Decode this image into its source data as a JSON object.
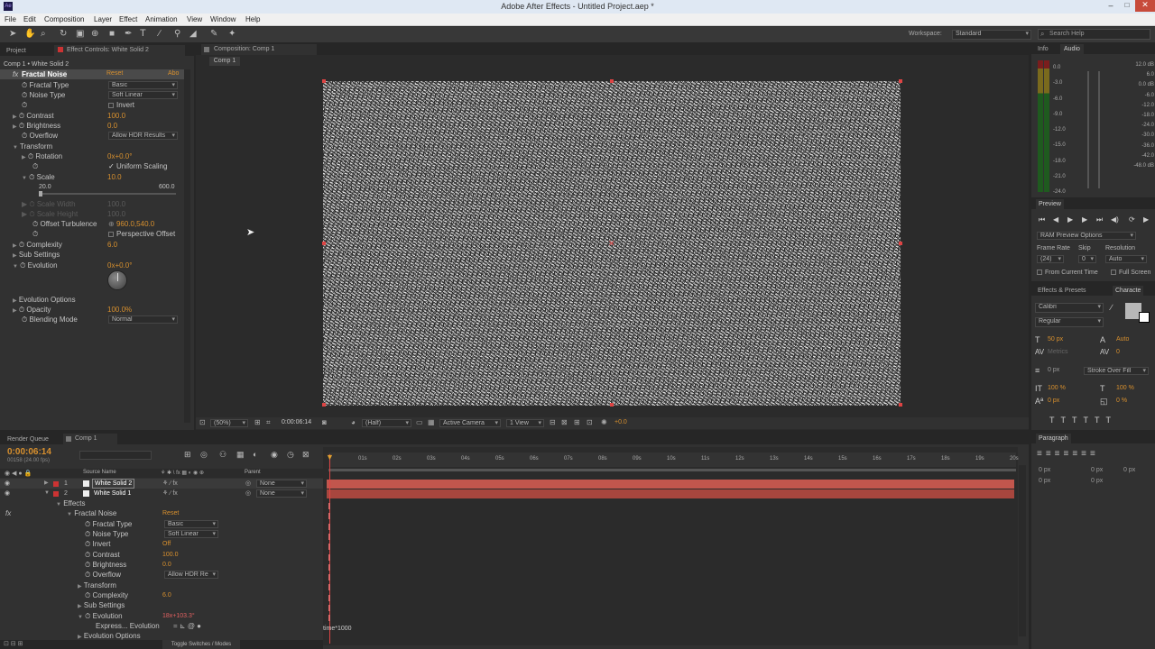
{
  "app": {
    "title": "Adobe After Effects - Untitled Project.aep *"
  },
  "menu": [
    "File",
    "Edit",
    "Composition",
    "Layer",
    "Effect",
    "Animation",
    "View",
    "Window",
    "Help"
  ],
  "toolbar": {
    "workspace_label": "Workspace:",
    "workspace_value": "Standard",
    "search_placeholder": "Search Help"
  },
  "left_panel": {
    "tab_project": "Project",
    "tab_effect_controls": "Effect Controls: White Solid 2",
    "header": "Comp 1 • White Solid 2",
    "effect_name": "Fractal Noise",
    "reset": "Reset",
    "about": "Abo",
    "props": {
      "fractal_type_label": "Fractal Type",
      "fractal_type_value": "Basic",
      "noise_type_label": "Noise Type",
      "noise_type_value": "Soft Linear",
      "invert_label": "Invert",
      "contrast_label": "Contrast",
      "contrast_value": "100.0",
      "brightness_label": "Brightness",
      "brightness_value": "0.0",
      "overflow_label": "Overflow",
      "overflow_value": "Allow HDR Results",
      "transform_label": "Transform",
      "rotation_label": "Rotation",
      "rotation_value": "0x+0.0°",
      "uniform_scaling_label": "Uniform Scaling",
      "scale_label": "Scale",
      "scale_value": "10.0",
      "scale_min": "20.0",
      "scale_max": "600.0",
      "scale_width_label": "Scale Width",
      "scale_width_value": "100.0",
      "scale_height_label": "Scale Height",
      "scale_height_value": "100.0",
      "offset_label": "Offset Turbulence",
      "offset_value": "960.0,540.0",
      "perspective_label": "Perspective Offset",
      "complexity_label": "Complexity",
      "complexity_value": "6.0",
      "sub_settings_label": "Sub Settings",
      "evolution_label": "Evolution",
      "evolution_value": "0x+0.0°",
      "evolution_options_label": "Evolution Options",
      "opacity_label": "Opacity",
      "opacity_value": "100.0%",
      "blending_label": "Blending Mode",
      "blending_value": "Normal"
    }
  },
  "comp": {
    "tab": "Composition: Comp 1",
    "subtab": "Comp 1",
    "zoom": "(50%)",
    "timecode": "0:00:06:14",
    "resolution": "(Half)",
    "camera": "Active Camera",
    "views": "1 View",
    "exposure": "+0.0"
  },
  "right": {
    "tab_info": "Info",
    "tab_audio": "Audio",
    "audio_left": [
      "0.0",
      "-3.0",
      "-6.0",
      "-9.0",
      "-12.0",
      "-15.0",
      "-18.0",
      "-21.0",
      "-24.0"
    ],
    "audio_right": [
      "12.0 dB",
      "6.0",
      "0.0 dB",
      "-6.0",
      "-12.0",
      "-18.0",
      "-24.0",
      "-30.0",
      "-36.0",
      "-42.0",
      "-48.0 dB"
    ],
    "preview_tab": "Preview",
    "ram_preview": "RAM Preview Options",
    "frame_rate_label": "Frame Rate",
    "skip_label": "Skip",
    "resolution_label": "Resolution",
    "frame_rate_value": "(24)",
    "skip_value": "0",
    "resolution_value": "Auto",
    "from_current": "From Current Time",
    "full_screen": "Full Screen",
    "effects_presets_tab": "Effects & Presets",
    "character_tab": "Characte",
    "font": "Calibri",
    "style": "Regular",
    "font_size": "50 px",
    "leading": "Auto",
    "kerning": "Metrics",
    "tracking": "0",
    "stroke_width": "0 px",
    "stroke_style": "Stroke Over Fill",
    "vscale": "100 %",
    "hscale": "100 %",
    "baseline": "0 px",
    "tsume": "0 %",
    "paragraph_tab": "Paragraph",
    "para_vals": [
      "0 px",
      "0 px",
      "0 px",
      "0 px",
      "0 px"
    ]
  },
  "timeline": {
    "render_queue_tab": "Render Queue",
    "comp_tab": "Comp 1",
    "timecode": "0:00:06:14",
    "timecode_sub": "00158 (24.00 fps)",
    "source_name_header": "Source Name",
    "parent_header": "Parent",
    "rulers": [
      "01s",
      "02s",
      "03s",
      "04s",
      "05s",
      "06s",
      "07s",
      "08s",
      "09s",
      "10s",
      "11s",
      "12s",
      "13s",
      "14s",
      "15s",
      "16s",
      "17s",
      "18s",
      "19s",
      "20s"
    ],
    "layers": [
      {
        "num": "1",
        "name": "White Solid 2",
        "parent": "None"
      },
      {
        "num": "2",
        "name": "White Solid 1",
        "parent": "None"
      }
    ],
    "props": {
      "effects": "Effects",
      "fractal_noise": "Fractal Noise",
      "reset": "Reset",
      "fractal_type": "Fractal Type",
      "fractal_type_value": "Basic",
      "noise_type": "Noise Type",
      "noise_type_value": "Soft Linear",
      "invert": "Invert",
      "invert_value": "Off",
      "contrast": "Contrast",
      "contrast_value": "100.0",
      "brightness": "Brightness",
      "brightness_value": "0.0",
      "overflow": "Overflow",
      "overflow_value": "Allow HDR Re",
      "transform": "Transform",
      "complexity": "Complexity",
      "complexity_value": "6.0",
      "sub_settings": "Sub Settings",
      "evolution": "Evolution",
      "evolution_value": "18x+103.3°",
      "expression": "Express... Evolution",
      "expression_text": "time*1000",
      "evolution_options": "Evolution Options"
    },
    "toggle_label": "Toggle Switches / Modes"
  }
}
